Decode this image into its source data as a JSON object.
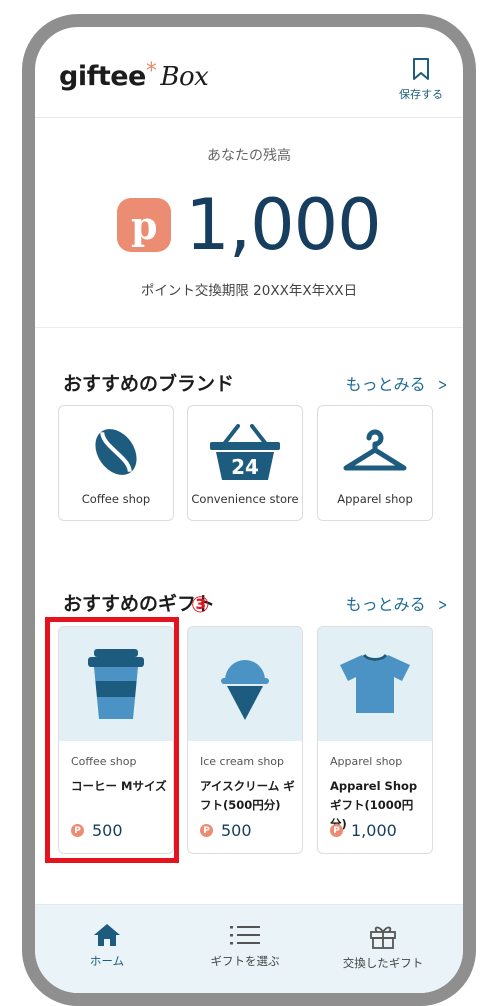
{
  "header": {
    "logo_main": "giftee",
    "logo_asterisk": "*",
    "logo_box": "Box",
    "save_label": "保存する"
  },
  "balance": {
    "label": "あなたの残高",
    "point_symbol": "p",
    "value": "1,000",
    "expiry": "ポイント交換期限 20XX年X年XX日"
  },
  "brands_section": {
    "title": "おすすめのブランド",
    "more_label": "もっとみる",
    "items": [
      {
        "name": "Coffee shop",
        "icon": "coffee-bean-icon"
      },
      {
        "name": "Convenience store",
        "icon": "shopping-basket-24-icon",
        "icon_text": "24"
      },
      {
        "name": "Apparel shop",
        "icon": "hanger-icon"
      }
    ]
  },
  "gifts_section": {
    "title": "おすすめのギフト",
    "more_label": "もっとみる",
    "annotation": "③",
    "items": [
      {
        "brand": "Coffee shop",
        "name": "コーヒー Mサイズ",
        "price": "500",
        "icon": "coffee-cup-icon"
      },
      {
        "brand": "Ice cream shop",
        "name": "アイスクリーム ギフト(500円分)",
        "price": "500",
        "icon": "ice-cream-icon"
      },
      {
        "brand": "Apparel shop",
        "name": "Apparel Shop ギフト(1000円分)",
        "price": "1,000",
        "icon": "tshirt-icon"
      }
    ]
  },
  "tabbar": {
    "items": [
      {
        "label": "ホーム",
        "icon": "home-icon",
        "active": true
      },
      {
        "label": "ギフトを選ぶ",
        "icon": "list-icon",
        "active": false
      },
      {
        "label": "交換したギフト",
        "icon": "gift-icon",
        "active": false
      }
    ]
  },
  "colors": {
    "accent": "#173e5e",
    "link": "#1d6a95",
    "point": "#ec8c72",
    "highlight": "#e4131e",
    "icon": "#1d5c7e",
    "tabbar_bg": "#eaf4f8"
  }
}
